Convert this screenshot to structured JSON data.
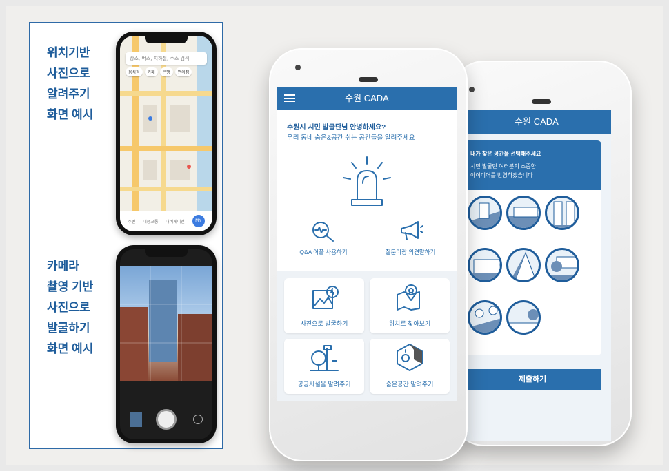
{
  "captions": {
    "map": "위치기반\n사진으로\n알려주기\n화면 예시",
    "camera": "카메라\n촬영 기반\n사진으로\n발굴하기\n화면 예시"
  },
  "map_screen": {
    "search_placeholder": "장소, 버스, 지하철, 주소 검색",
    "chips": [
      "음식점",
      "카페",
      "은행",
      "편의점"
    ],
    "bottom_tabs": [
      "주변",
      "대중교통",
      "내비게이션",
      "MY"
    ]
  },
  "front_phone": {
    "app_title": "수원 CADA",
    "greeting_title": "수원시 시민 발굴단님 안녕하세요?",
    "greeting_sub": "우리 동네 숨은&공간 쉬는 공간들을 알려주세요",
    "quick_links": [
      "Q&A 어플 사용하기",
      "질문이랑 의견말하기"
    ],
    "tiles": [
      "사진으로 발굴하기",
      "위치로 찾아보기",
      "공공시설을 알려주기",
      "숨은공간 알려주기"
    ]
  },
  "back_phone": {
    "app_title": "수원 CADA",
    "card_title": "내가 찾은 공간을 선택해주세요",
    "card_sub_1": "시민 발굴단 여러분의 소중한",
    "card_sub_2": "아이디어를 반영하겠습니다",
    "submit_label": "제출하기"
  },
  "colors": {
    "brand_blue": "#2a6fad",
    "caption_blue": "#1f5d9b"
  }
}
